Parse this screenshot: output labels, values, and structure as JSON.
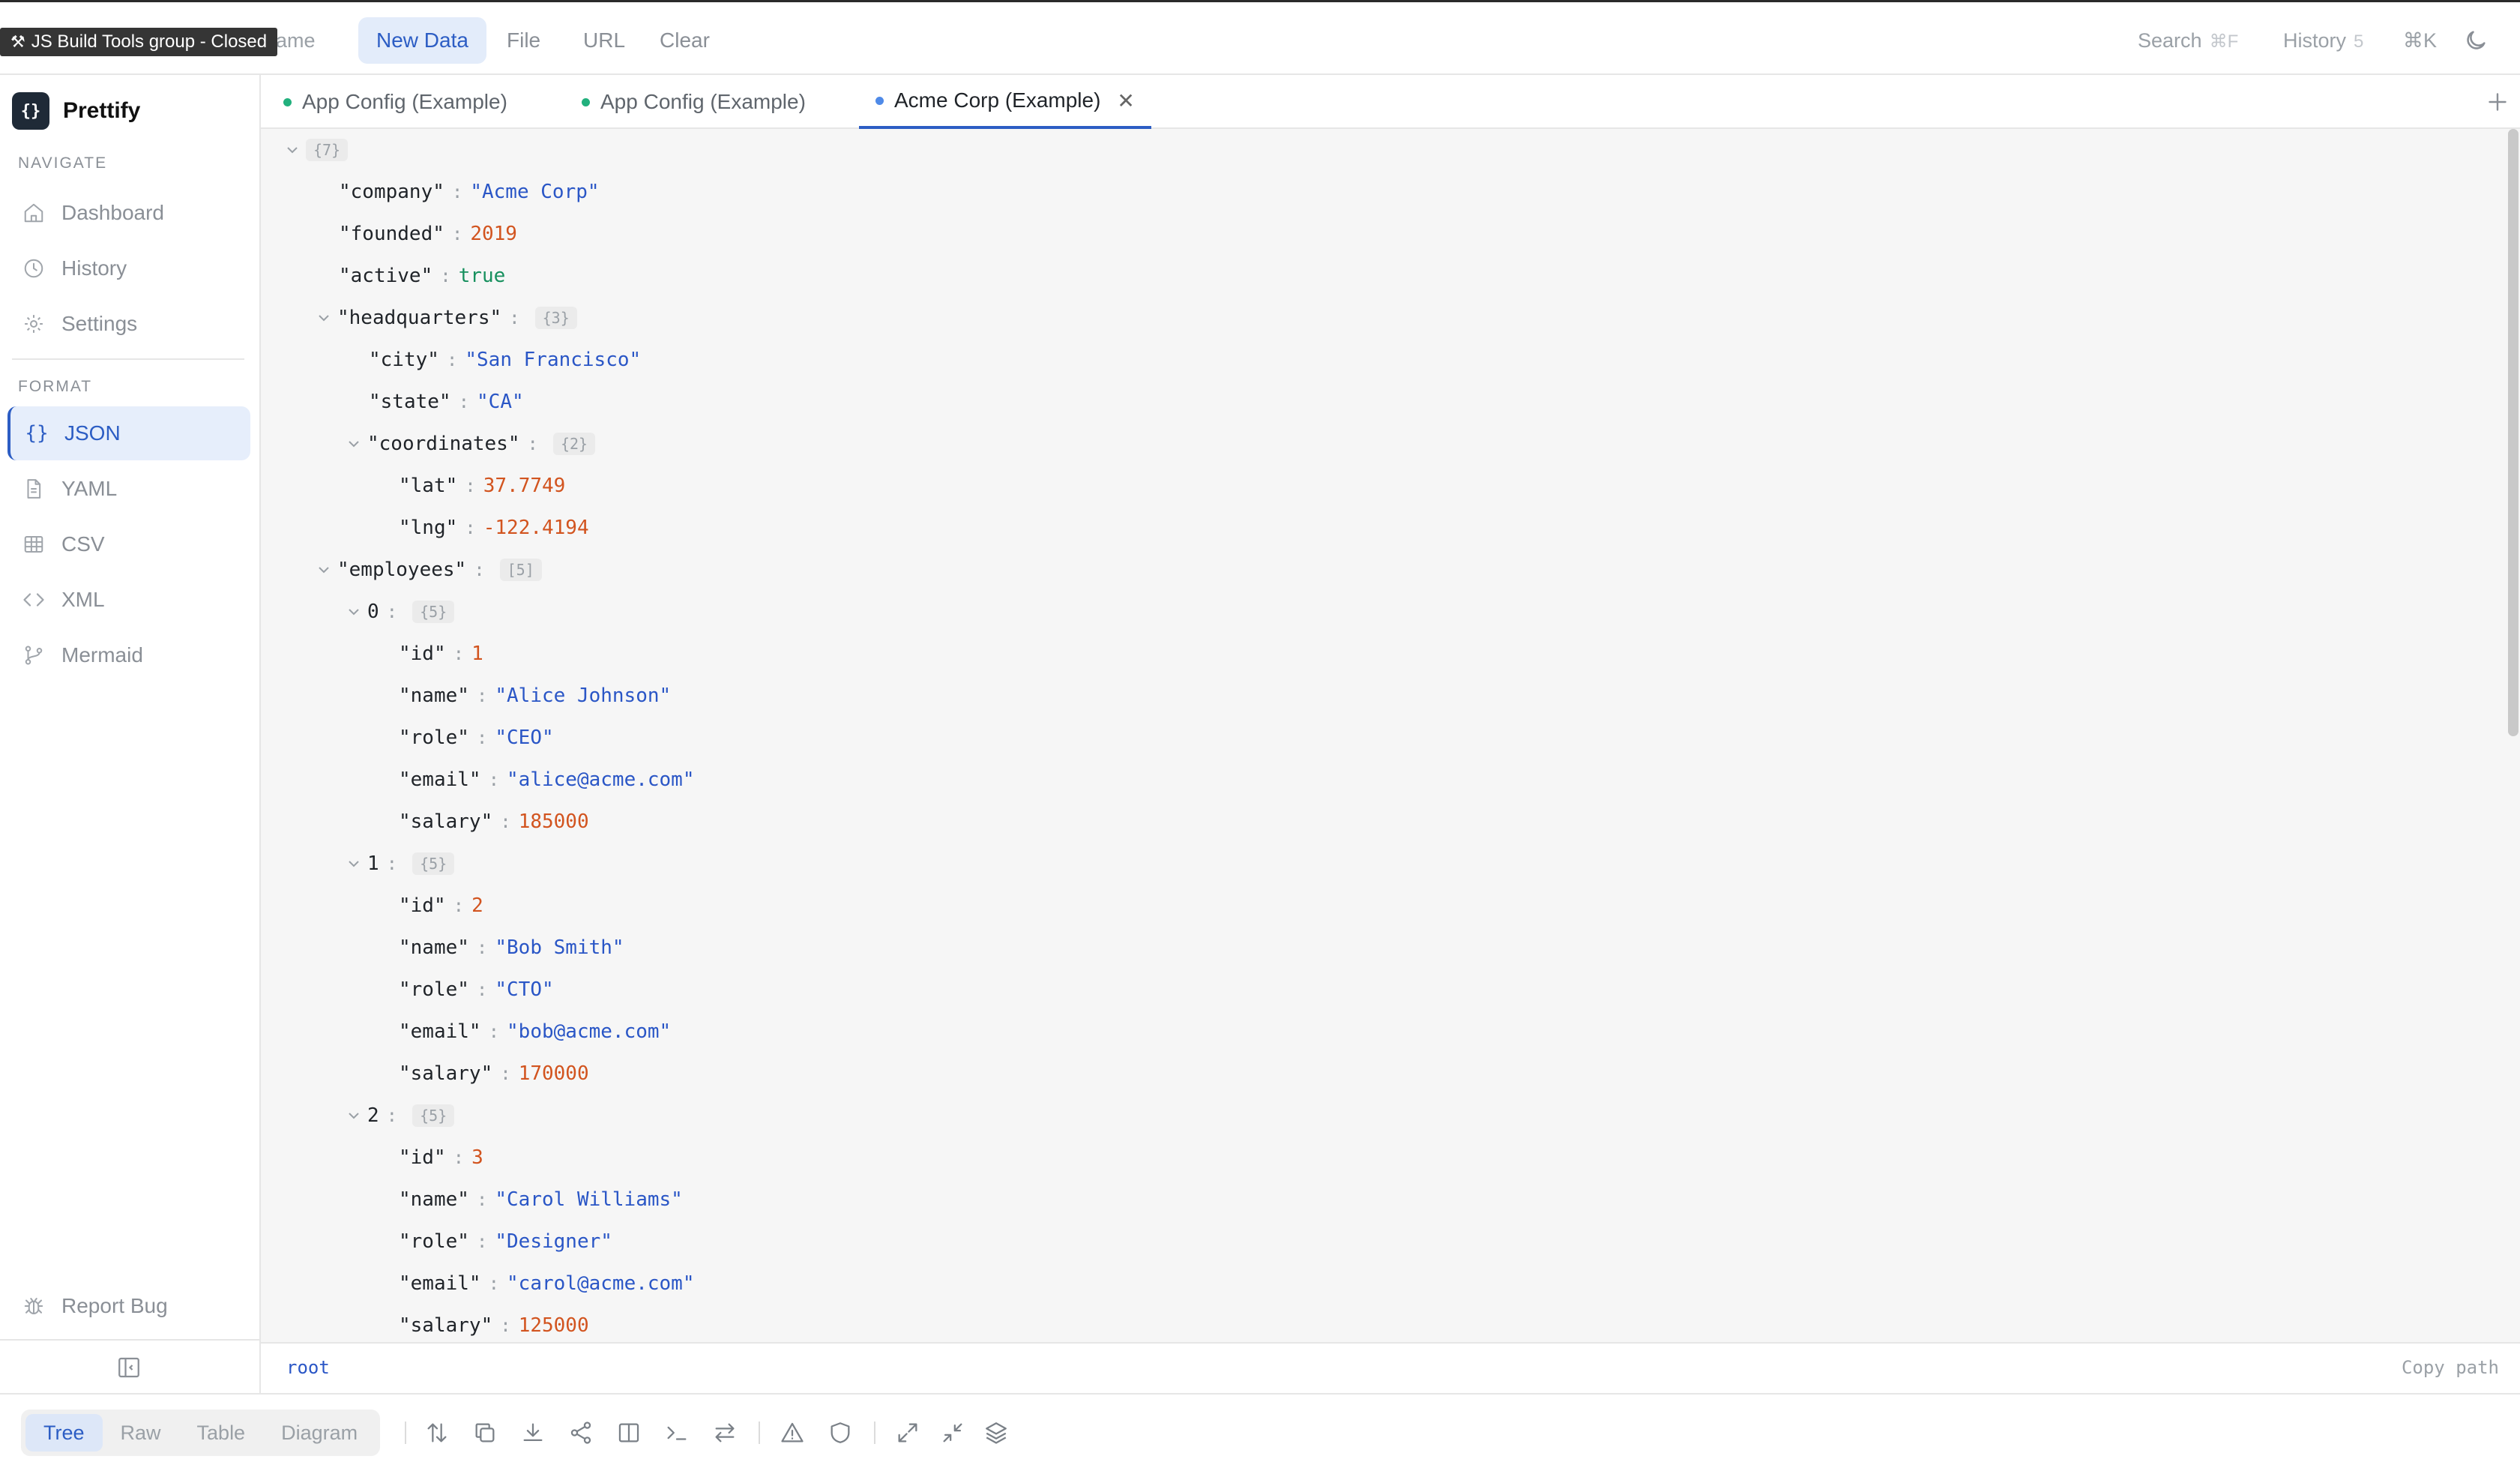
{
  "topbar": {
    "tooltip": "JS Build Tools group - Closed",
    "ghost_text": "ame",
    "buttons": [
      "New Data",
      "File",
      "URL",
      "Clear"
    ],
    "search_label": "Search",
    "search_kbd": "⌘F",
    "history_label": "History",
    "history_count": "5",
    "cmd_k": "⌘K"
  },
  "sidebar": {
    "brand": "Prettify",
    "brand_logo": "{}",
    "navigate_title": "NAVIGATE",
    "navigate": [
      {
        "label": "Dashboard",
        "icon": "home-icon"
      },
      {
        "label": "History",
        "icon": "clock-icon"
      },
      {
        "label": "Settings",
        "icon": "gear-icon"
      }
    ],
    "format_title": "FORMAT",
    "formats": [
      {
        "label": "JSON",
        "icon": "braces-icon",
        "active": true
      },
      {
        "label": "YAML",
        "icon": "file-icon"
      },
      {
        "label": "CSV",
        "icon": "table-icon"
      },
      {
        "label": "XML",
        "icon": "code-icon"
      },
      {
        "label": "Mermaid",
        "icon": "branch-icon"
      }
    ],
    "report_bug": "Report Bug"
  },
  "tabs": [
    {
      "label": "App Config (Example)",
      "active": false
    },
    {
      "label": "App Config (Example)",
      "active": false
    },
    {
      "label": "Acme Corp (Example)",
      "active": true
    }
  ],
  "tree": {
    "root_count": "{7}",
    "company_key": "\"company\"",
    "company_val": "\"Acme Corp\"",
    "founded_key": "\"founded\"",
    "founded_val": "2019",
    "active_key": "\"active\"",
    "active_val": "true",
    "hq_key": "\"headquarters\"",
    "hq_count": "{3}",
    "city_key": "\"city\"",
    "city_val": "\"San Francisco\"",
    "state_key": "\"state\"",
    "state_val": "\"CA\"",
    "coords_key": "\"coordinates\"",
    "coords_count": "{2}",
    "lat_key": "\"lat\"",
    "lat_val": "37.7749",
    "lng_key": "\"lng\"",
    "lng_val": "-122.4194",
    "emp_key": "\"employees\"",
    "emp_count": "[5]",
    "employees": [
      {
        "index": "0",
        "count": "{5}",
        "id": "1",
        "name": "\"Alice Johnson\"",
        "role": "\"CEO\"",
        "email": "\"alice@acme.com\"",
        "salary": "185000"
      },
      {
        "index": "1",
        "count": "{5}",
        "id": "2",
        "name": "\"Bob Smith\"",
        "role": "\"CTO\"",
        "email": "\"bob@acme.com\"",
        "salary": "170000"
      },
      {
        "index": "2",
        "count": "{5}",
        "id": "3",
        "name": "\"Carol Williams\"",
        "role": "\"Designer\"",
        "email": "\"carol@acme.com\"",
        "salary": "125000"
      }
    ],
    "field_keys": {
      "id": "\"id\"",
      "name": "\"name\"",
      "role": "\"role\"",
      "email": "\"email\"",
      "salary": "\"salary\""
    }
  },
  "pathbar": {
    "path": "root",
    "copy": "Copy path"
  },
  "bottombar": {
    "views": [
      "Tree",
      "Raw",
      "Table",
      "Diagram"
    ],
    "active_view": "Tree"
  }
}
